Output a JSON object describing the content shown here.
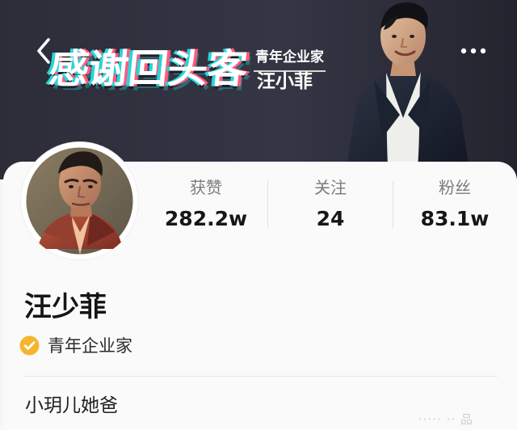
{
  "banner": {
    "headline": "感谢回头客",
    "subtitle": "青年企业家",
    "name": "汪小菲",
    "background_color": "#2d2e39",
    "accent_colors": [
      "#2bd4d8",
      "#ff5a80"
    ]
  },
  "header": {
    "back_icon": "chevron-left-icon",
    "more_icon": "more-dots-icon"
  },
  "profile": {
    "name": "汪少菲",
    "verified_label": "青年企业家",
    "verified_icon": "checkmark-badge-icon",
    "bio": "小玥儿她爸"
  },
  "stats": [
    {
      "label": "获赞",
      "value": "282.2w"
    },
    {
      "label": "关注",
      "value": "24"
    },
    {
      "label": "粉丝",
      "value": "83.1w"
    }
  ],
  "watermark": {
    "text": "····· ·· 品"
  }
}
